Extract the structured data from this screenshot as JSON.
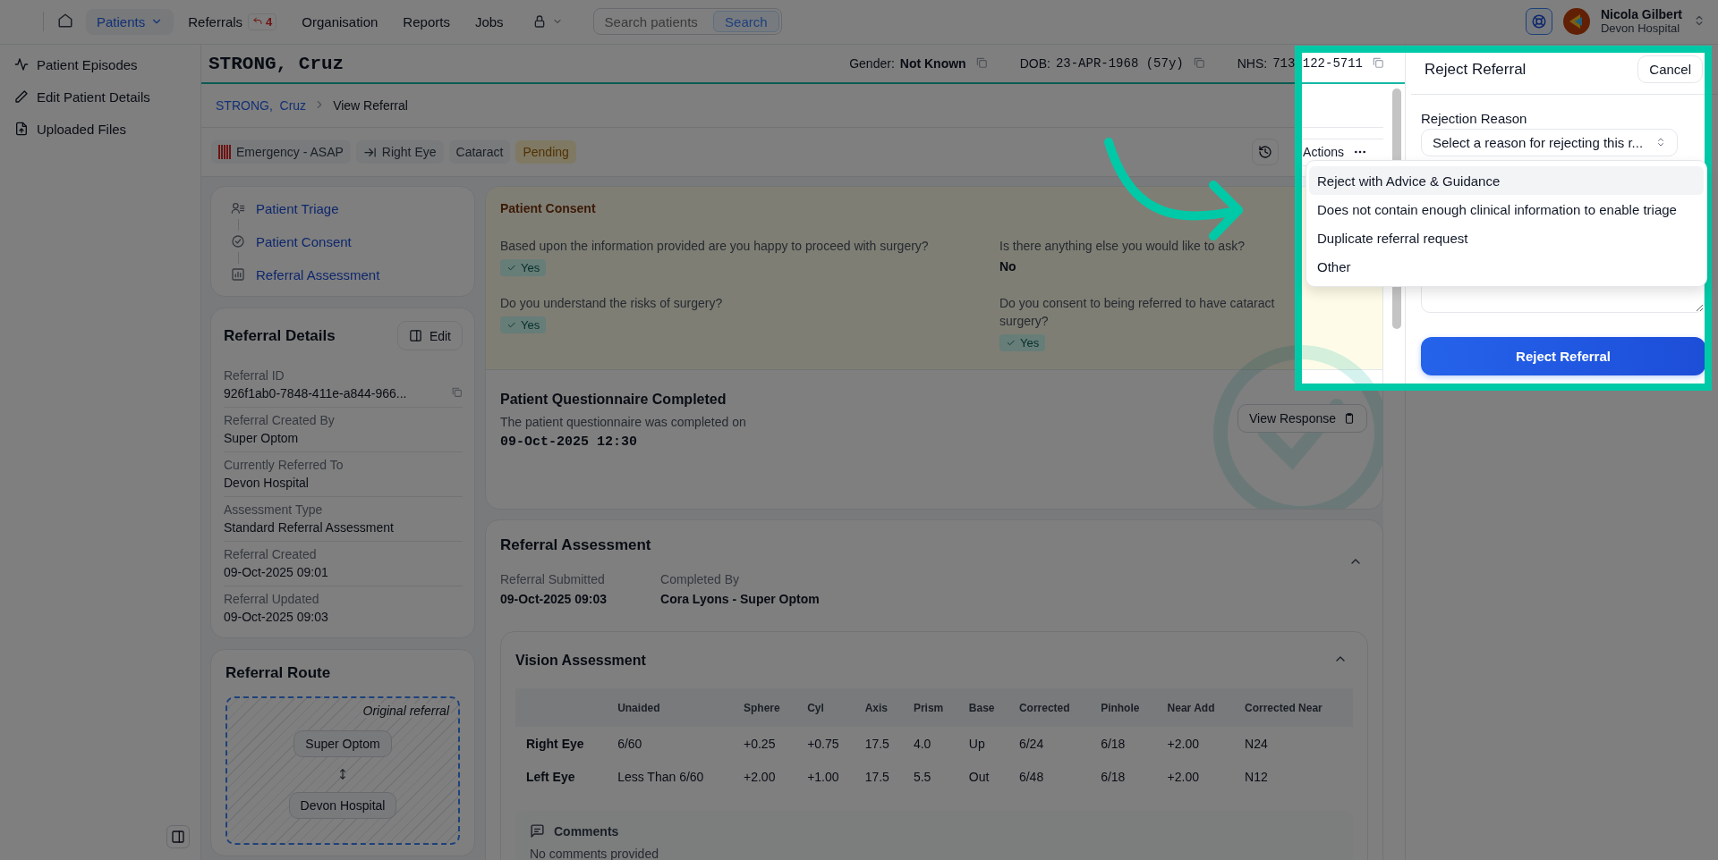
{
  "nav": {
    "items": [
      {
        "label": "Patients",
        "selected": true,
        "kind": "menu"
      },
      {
        "label": "Referrals",
        "selected": false,
        "kind": "badge",
        "badge": "4"
      },
      {
        "label": "Organisation",
        "selected": false,
        "kind": "link"
      },
      {
        "label": "Reports",
        "selected": false,
        "kind": "link"
      },
      {
        "label": "Jobs",
        "selected": false,
        "kind": "link"
      }
    ],
    "search": {
      "placeholder": "Search patients",
      "button": "Search"
    },
    "user": {
      "name": "Nicola Gilbert",
      "organisation": "Devon Hospital"
    }
  },
  "sidebar": {
    "items": [
      "Patient Episodes",
      "Edit Patient Details",
      "Uploaded Files"
    ]
  },
  "patient": {
    "name": "STRONG, Cruz",
    "fields": [
      {
        "label": "Gender:",
        "value": "Not Known",
        "kind": "bold"
      },
      {
        "label": "DOB:",
        "value": "23-APR-1968 (57y)",
        "kind": "mono"
      },
      {
        "label": "NHS:",
        "value": "713-122-5711",
        "kind": "mono"
      }
    ]
  },
  "breadcrumb": [
    {
      "label": "STRONG,  Cruz",
      "link": true
    },
    {
      "label": "View Referral",
      "link": false
    }
  ],
  "tags": [
    {
      "label": "Emergency - ASAP",
      "kind": "urgency"
    },
    {
      "label": "Right Eye",
      "kind": "eye"
    },
    {
      "label": "Cataract",
      "kind": "plain"
    },
    {
      "label": "Pending",
      "kind": "status"
    }
  ],
  "actions": "Actions",
  "sections": [
    "Patient Triage",
    "Patient Consent",
    "Referral Assessment"
  ],
  "referral_details": {
    "title": "Referral Details",
    "edit": "Edit",
    "fields": [
      {
        "label": "Referral ID",
        "value": "926f1ab0-7848-411e-a844-966...",
        "copyable": true
      },
      {
        "label": "Referral Created By",
        "value": "Super Optom",
        "copyable": false
      },
      {
        "label": "Currently Referred To",
        "value": "Devon Hospital",
        "copyable": false
      },
      {
        "label": "Assessment Type",
        "value": "Standard Referral Assessment",
        "copyable": false
      },
      {
        "label": "Referral Created",
        "value": "09-Oct-2025 09:01",
        "copyable": false
      },
      {
        "label": "Referral Updated",
        "value": "09-Oct-2025 09:03",
        "copyable": false
      }
    ]
  },
  "referral_route": {
    "title": "Referral Route",
    "caption": "Original referral",
    "nodes": [
      "Super Optom",
      "Devon Hospital"
    ]
  },
  "consent": {
    "title": "Patient Consent",
    "questions": [
      {
        "question": "Based upon the information provided are you happy to proceed with surgery?",
        "answer": "Yes",
        "kind": "chip"
      },
      {
        "question": "Is there anything else you would like to ask?",
        "answer": "No",
        "kind": "text"
      },
      {
        "question": "Do you understand the risks of surgery?",
        "answer": "Yes",
        "kind": "chip"
      },
      {
        "question": "Do you consent to being referred to have cataract surgery?",
        "answer": "Yes",
        "kind": "chip"
      }
    ]
  },
  "questionnaire": {
    "title": "Patient Questionnaire Completed",
    "text": "The patient questionnaire was completed on",
    "completed_at": "09-Oct-2025 12:30",
    "button": "View Response"
  },
  "assessment": {
    "title": "Referral Assessment",
    "expanded": true,
    "fields": [
      {
        "label": "Referral Submitted",
        "value": "09-Oct-2025 09:03"
      },
      {
        "label": "Completed By",
        "value": "Cora Lyons - Super Optom"
      }
    ],
    "vision": {
      "title": "Vision Assessment",
      "expanded": true,
      "columns": [
        "Unaided",
        "Sphere",
        "Cyl",
        "Axis",
        "Prism",
        "Base",
        "Corrected",
        "Pinhole",
        "Near Add",
        "Corrected Near"
      ],
      "rows": [
        {
          "label": "Right Eye",
          "cells": [
            "6/60",
            "+0.25",
            "+0.75",
            "17.5",
            "4.0",
            "Up",
            "6/24",
            "6/18",
            "+2.00",
            "N24"
          ]
        },
        {
          "label": "Left Eye",
          "cells": [
            "Less Than 6/60",
            "+2.00",
            "+1.00",
            "17.5",
            "5.5",
            "Out",
            "6/48",
            "6/18",
            "+2.00",
            "N12"
          ]
        }
      ],
      "comments": {
        "title": "Comments",
        "text": "No comments provided"
      }
    }
  },
  "panel": {
    "title": "Reject Referral",
    "cancel": "Cancel",
    "reason_label": "Rejection Reason",
    "placeholder": "Select a reason for rejecting this r...",
    "options": [
      {
        "label": "Reject with Advice & Guidance",
        "selected": true
      },
      {
        "label": "Does not contain enough clinical information to enable triage",
        "selected": false
      },
      {
        "label": "Duplicate referral request",
        "selected": false
      },
      {
        "label": "Other",
        "selected": false
      }
    ],
    "submit": "Reject Referral"
  }
}
